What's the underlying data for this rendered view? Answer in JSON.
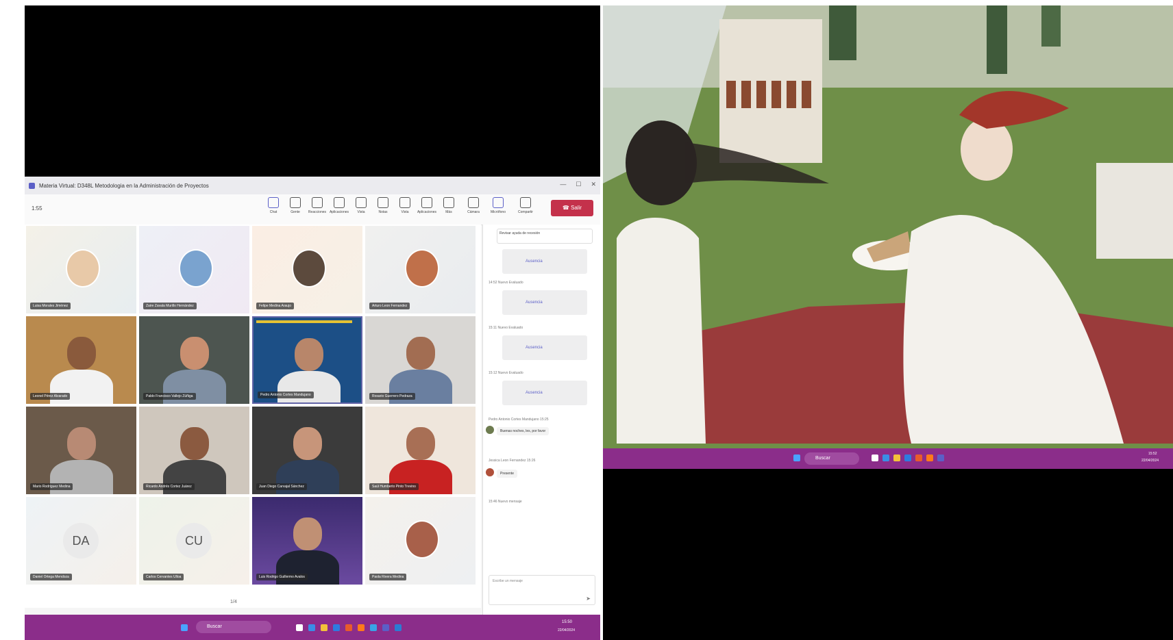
{
  "left_screen": {
    "window_title": "Materia Virtual: D348L Metodologia en la Administración de Proyectos",
    "window_controls": [
      "—",
      "☐",
      "✕"
    ],
    "toolbar": {
      "left_label": "1:55",
      "tools": [
        "Chat",
        "Gente",
        "Reacciones",
        "Aplicaciones",
        "Vista",
        "Notas",
        "Vista",
        "Aplicaciones",
        "Más",
        "Cámara",
        "Micrófono",
        "Compartir"
      ],
      "leave_label": "Salir"
    },
    "participants": [
      "Luisa Morales Jiménez",
      "Zaire Zavala Murillo Hernández",
      "Felipe Medina Araujo",
      "Arturo Leon Fernandez",
      "Leonel Pérez Alvarado",
      "Pablo Francisco Vallejo Zúñiga",
      "Pedro Antonio Cortes Mandujano",
      "Rosario Guerrero Pedraza",
      "Mario Rodriguez Medina",
      "Ricardo Andrés Cortez Juárez",
      "Juan Diego Carvajal Sánchez",
      "Saúl Humberto Pinto Trevino",
      "Daniel Ortega Mendoza",
      "Carlos Cervantes Ulloa",
      "Luis Rodrigo Guillermo Avalos",
      "Paola Rivera Medina"
    ],
    "initials_tiles": [
      "DA",
      "CU"
    ],
    "pager": "1/4",
    "chat": {
      "top_card": "Revisar ayuda de recesión",
      "items": [
        {
          "label": "Ausencia"
        },
        {
          "meta": "14:52  Nuevo Evaluado",
          "label": "Ausencia"
        },
        {
          "meta": "15:11  Nuevo Evaluado",
          "label": "Ausencia"
        },
        {
          "meta": "15:12  Nuevo Evaluado",
          "label": "Ausencia"
        }
      ],
      "messages": [
        {
          "author": "Pedro Antonio Cortes Mandujano  15:25",
          "text": "Buenas noches, les, por favor"
        },
        {
          "author": "Jessica Leon Fernandez  15:26",
          "text": "Presente"
        }
      ],
      "system_line": "15:46  Nuevo mensaje",
      "input_placeholder": "Escribe un mensaje"
    },
    "taskbar": {
      "search_label": "Buscar",
      "time": "15:50",
      "date": "22/04/2024"
    }
  },
  "right_screen": {
    "taskbar": {
      "search_label": "Buscar",
      "time": "15:52",
      "date": "22/04/2024"
    }
  },
  "colors": {
    "taskbar": "#8b2d8a",
    "teams_accent": "#5b5fc7",
    "leave_button": "#c4314b"
  }
}
